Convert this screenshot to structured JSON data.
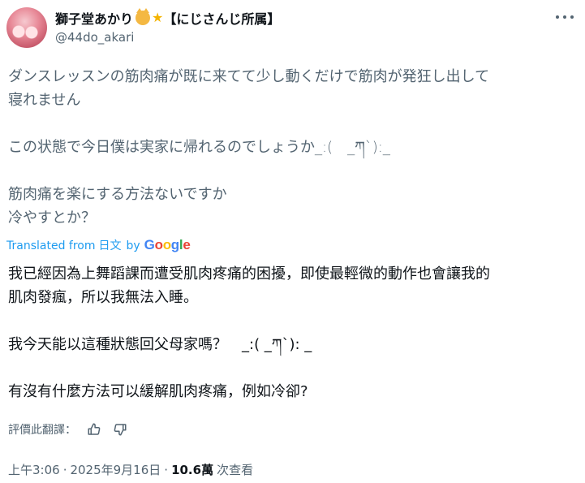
{
  "author": {
    "display_name": "獅子堂あかり",
    "badge_text": "【にじさんじ所属】",
    "handle": "@44do_akari",
    "emoji": [
      "cat-face",
      "sparkle-star"
    ]
  },
  "original_text": {
    "lines": [
      "ダンスレッスンの筋肉痛が既に来てて少し動くだけで筋肉が発狂し出して",
      "寝れません",
      "",
      "この状態で今日僕は実家に帰れるのでしょうか_:(　_ཀ`):_",
      "",
      "筋肉痛を楽にする方法ないですか",
      "冷やすとか？"
    ]
  },
  "translation_attribution": {
    "prefix": "Translated from",
    "language": "日文",
    "by": "by",
    "provider": "Google"
  },
  "translated_text": {
    "lines": [
      "我已經因為上舞蹈課而遭受肌肉疼痛的困擾，即使最輕微的動作也會讓我的",
      "肌肉發瘋，所以我無法入睡。",
      "",
      "我今天能以這種狀態回父母家嗎？　_:( _ཀ`): _",
      "",
      "有沒有什麼方法可以緩解肌肉疼痛，例如冷卻?"
    ]
  },
  "rate_translation": {
    "label": "評價此翻譯："
  },
  "meta": {
    "time": "上午3:06",
    "separator": "·",
    "date": "2025年9月16日",
    "views_count": "10.6萬",
    "views_label": "次查看"
  },
  "colors": {
    "primary_text": "#0f1419",
    "secondary_text": "#536471",
    "link_blue": "#1d9bf0"
  }
}
